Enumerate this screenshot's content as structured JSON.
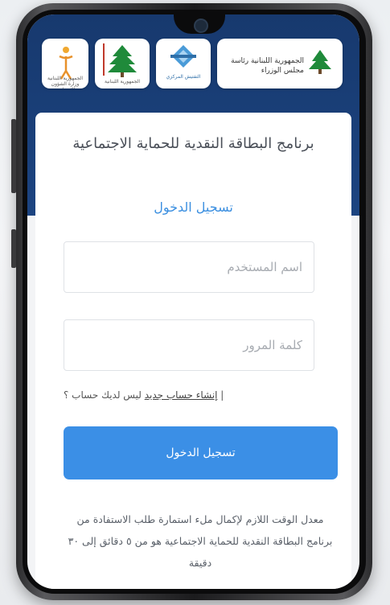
{
  "header": {
    "logos": [
      {
        "name": "ministry-social-affairs-logo",
        "caption": "الجمهورية اللبنانية وزارة الشؤون الاجتماعية"
      },
      {
        "name": "cedar-presidency-logo",
        "caption": "الجمهورية اللبنانية"
      },
      {
        "name": "blue-emblem-logo",
        "caption": "التفتيش المركزي"
      },
      {
        "name": "council-of-ministers-logo",
        "caption": "الجمهورية اللبنانية رئاسة مجلس الوزراء"
      }
    ]
  },
  "card": {
    "program_title": "برنامج البطاقة النقدية للحماية الاجتماعية",
    "login_heading": "تسجيل الدخول",
    "username_placeholder": "اسم المستخدم",
    "password_placeholder": "كلمة المرور",
    "no_account_text": "ليس لديك حساب ؟ |",
    "create_account_link": "إنشاء حساب جديد",
    "login_button": "تسجيل الدخول",
    "info_text": "معدل الوقت اللازم لإكمال ملء استمارة طلب الاستفادة من برنامج البطاقة النقدية للحماية الاجتماعية هو من ٥ دقائق إلى ٣٠ دقيقة"
  },
  "colors": {
    "header_blue": "#1c4481",
    "accent_blue": "#3b8fe6"
  }
}
